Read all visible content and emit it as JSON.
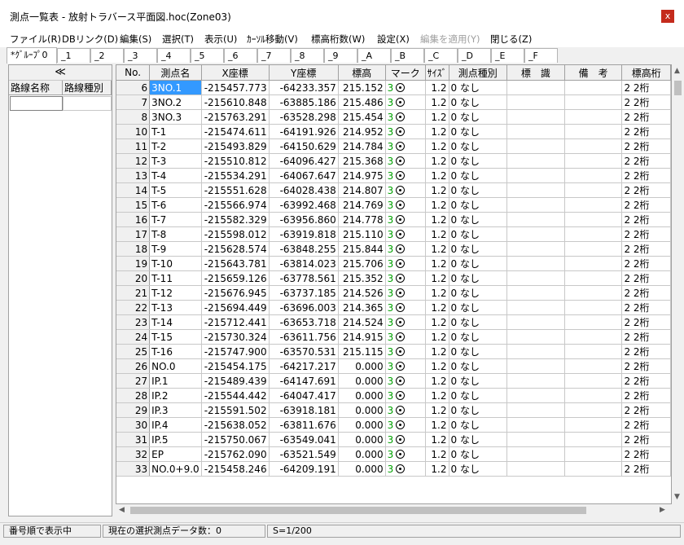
{
  "window": {
    "title": "測点一覧表 - 放射トラバース平面図.hoc(Zone03)",
    "close_label": "x"
  },
  "menu": [
    "ファイル(R)",
    "DBリンク(D)",
    "編集(S)",
    "選択(T)",
    "表示(U)",
    "ｶｰｿﾙ移動(V)",
    "標高桁数(W)",
    "設定(X)",
    "編集を適用(Y)",
    "閉じる(Z)"
  ],
  "tabs": [
    "*ｸﾞﾙｰﾌﾟ0",
    "_1",
    "_2",
    "_3",
    "_4",
    "_5",
    "_6",
    "_7",
    "_8",
    "_9",
    "_A",
    "_B",
    "_C",
    "_D",
    "_E",
    "_F"
  ],
  "left_panel": {
    "collapse_label": "≪",
    "headers": [
      "路線名称",
      "路線種別"
    ]
  },
  "grid": {
    "headers": [
      "No.",
      "測点名",
      "X座標",
      "Y座標",
      "標高",
      "マーク",
      "ｻｲｽﾞ",
      "測点種別",
      "標　識",
      "備　考",
      "標高桁"
    ],
    "rows": [
      [
        "6",
        "3NO.1",
        "-215457.773",
        "-64233.357",
        "215.152",
        "3",
        "1.2",
        "0 なし",
        "",
        "",
        "2 2桁"
      ],
      [
        "7",
        "3NO.2",
        "-215610.848",
        "-63885.186",
        "215.486",
        "3",
        "1.2",
        "0 なし",
        "",
        "",
        "2 2桁"
      ],
      [
        "8",
        "3NO.3",
        "-215763.291",
        "-63528.298",
        "215.454",
        "3",
        "1.2",
        "0 なし",
        "",
        "",
        "2 2桁"
      ],
      [
        "10",
        "T-1",
        "-215474.611",
        "-64191.926",
        "214.952",
        "3",
        "1.2",
        "0 なし",
        "",
        "",
        "2 2桁"
      ],
      [
        "11",
        "T-2",
        "-215493.829",
        "-64150.629",
        "214.784",
        "3",
        "1.2",
        "0 なし",
        "",
        "",
        "2 2桁"
      ],
      [
        "12",
        "T-3",
        "-215510.812",
        "-64096.427",
        "215.368",
        "3",
        "1.2",
        "0 なし",
        "",
        "",
        "2 2桁"
      ],
      [
        "13",
        "T-4",
        "-215534.291",
        "-64067.647",
        "214.975",
        "3",
        "1.2",
        "0 なし",
        "",
        "",
        "2 2桁"
      ],
      [
        "14",
        "T-5",
        "-215551.628",
        "-64028.438",
        "214.807",
        "3",
        "1.2",
        "0 なし",
        "",
        "",
        "2 2桁"
      ],
      [
        "15",
        "T-6",
        "-215566.974",
        "-63992.468",
        "214.769",
        "3",
        "1.2",
        "0 なし",
        "",
        "",
        "2 2桁"
      ],
      [
        "16",
        "T-7",
        "-215582.329",
        "-63956.860",
        "214.778",
        "3",
        "1.2",
        "0 なし",
        "",
        "",
        "2 2桁"
      ],
      [
        "17",
        "T-8",
        "-215598.012",
        "-63919.818",
        "215.110",
        "3",
        "1.2",
        "0 なし",
        "",
        "",
        "2 2桁"
      ],
      [
        "18",
        "T-9",
        "-215628.574",
        "-63848.255",
        "215.844",
        "3",
        "1.2",
        "0 なし",
        "",
        "",
        "2 2桁"
      ],
      [
        "19",
        "T-10",
        "-215643.781",
        "-63814.023",
        "215.706",
        "3",
        "1.2",
        "0 なし",
        "",
        "",
        "2 2桁"
      ],
      [
        "20",
        "T-11",
        "-215659.126",
        "-63778.561",
        "215.352",
        "3",
        "1.2",
        "0 なし",
        "",
        "",
        "2 2桁"
      ],
      [
        "21",
        "T-12",
        "-215676.945",
        "-63737.185",
        "214.526",
        "3",
        "1.2",
        "0 なし",
        "",
        "",
        "2 2桁"
      ],
      [
        "22",
        "T-13",
        "-215694.449",
        "-63696.003",
        "214.365",
        "3",
        "1.2",
        "0 なし",
        "",
        "",
        "2 2桁"
      ],
      [
        "23",
        "T-14",
        "-215712.441",
        "-63653.718",
        "214.524",
        "3",
        "1.2",
        "0 なし",
        "",
        "",
        "2 2桁"
      ],
      [
        "24",
        "T-15",
        "-215730.324",
        "-63611.756",
        "214.915",
        "3",
        "1.2",
        "0 なし",
        "",
        "",
        "2 2桁"
      ],
      [
        "25",
        "T-16",
        "-215747.900",
        "-63570.531",
        "215.115",
        "3",
        "1.2",
        "0 なし",
        "",
        "",
        "2 2桁"
      ],
      [
        "26",
        "NO.0",
        "-215454.175",
        "-64217.217",
        "0.000",
        "3",
        "1.2",
        "0 なし",
        "",
        "",
        "2 2桁"
      ],
      [
        "27",
        "IP.1",
        "-215489.439",
        "-64147.691",
        "0.000",
        "3",
        "1.2",
        "0 なし",
        "",
        "",
        "2 2桁"
      ],
      [
        "28",
        "IP.2",
        "-215544.442",
        "-64047.417",
        "0.000",
        "3",
        "1.2",
        "0 なし",
        "",
        "",
        "2 2桁"
      ],
      [
        "29",
        "IP.3",
        "-215591.502",
        "-63918.181",
        "0.000",
        "3",
        "1.2",
        "0 なし",
        "",
        "",
        "2 2桁"
      ],
      [
        "30",
        "IP.4",
        "-215638.052",
        "-63811.676",
        "0.000",
        "3",
        "1.2",
        "0 なし",
        "",
        "",
        "2 2桁"
      ],
      [
        "31",
        "IP.5",
        "-215750.067",
        "-63549.041",
        "0.000",
        "3",
        "1.2",
        "0 なし",
        "",
        "",
        "2 2桁"
      ],
      [
        "32",
        "EP",
        "-215762.090",
        "-63521.549",
        "0.000",
        "3",
        "1.2",
        "0 なし",
        "",
        "",
        "2 2桁"
      ],
      [
        "33",
        "NO.0+9.0",
        "-215458.246",
        "-64209.191",
        "0.000",
        "3",
        "1.2",
        "0 なし",
        "",
        "",
        "2 2桁"
      ]
    ]
  },
  "status": {
    "sort": "番号順で表示中",
    "selection": "現在の選択測点データ数：0",
    "scale": "S=1/200"
  },
  "colors": {
    "selection": "#3399ff",
    "size_green": "#00a000",
    "close_red": "#c42b1c"
  }
}
